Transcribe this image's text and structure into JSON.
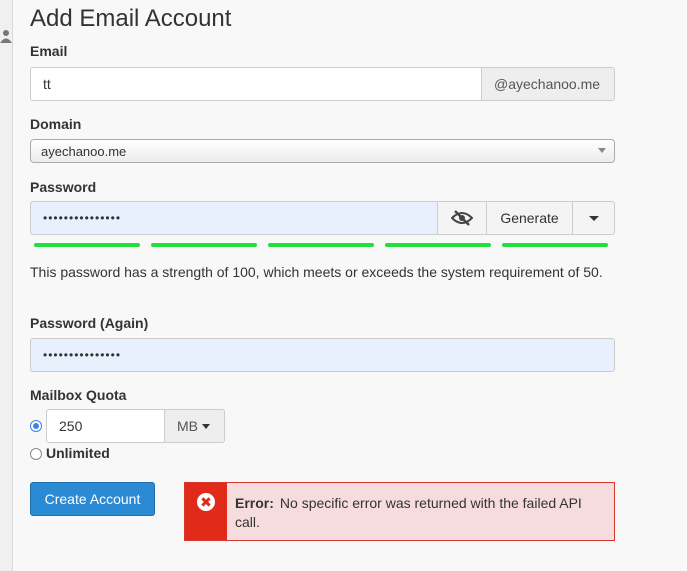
{
  "page": {
    "title": "Add Email Account"
  },
  "email": {
    "label": "Email",
    "value": "tt",
    "domain_suffix": "@ayechanoo.me"
  },
  "domain": {
    "label": "Domain",
    "selected": "ayechanoo.me"
  },
  "password": {
    "label": "Password",
    "value": "•••••••••••••••",
    "toggle_icon": "eye-slash-icon",
    "generate_label": "Generate",
    "strength_segments": 5,
    "strength_percent": 100,
    "strength_color": "#22e03c",
    "help_text": "This password has a strength of 100, which meets or exceeds the system requirement of 50."
  },
  "password_again": {
    "label": "Password (Again)",
    "value": "•••••••••••••••"
  },
  "quota": {
    "label": "Mailbox Quota",
    "value": "250",
    "unit": "MB",
    "unlimited_label": "Unlimited",
    "selected": "custom"
  },
  "actions": {
    "create_label": "Create Account"
  },
  "error": {
    "title": "Error:",
    "message": "No specific error was returned with the failed API call.",
    "icon": "error-x-icon",
    "colors": {
      "accent": "#e02b1b",
      "background": "#f6dcdc"
    }
  },
  "colors": {
    "primary_button": "#2a8ad3",
    "autofill_bg": "#e8f0fe"
  }
}
